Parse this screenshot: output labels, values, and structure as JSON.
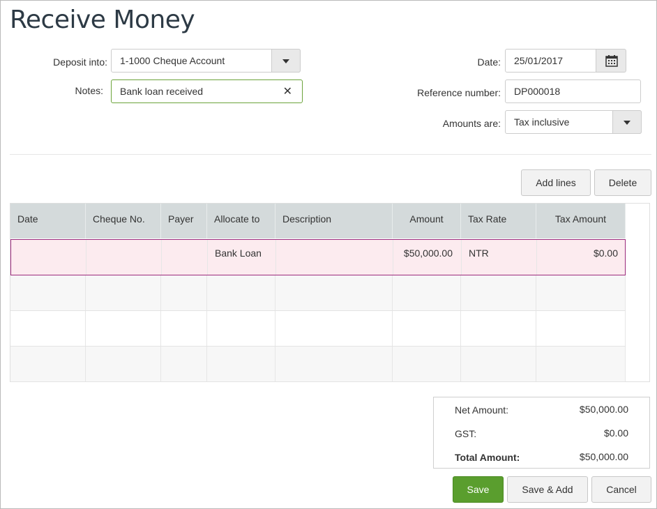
{
  "page": {
    "title": "Receive Money"
  },
  "form": {
    "deposit_label": "Deposit into:",
    "deposit_value": "1-1000 Cheque Account",
    "notes_label": "Notes:",
    "notes_value": "Bank loan received",
    "date_label": "Date:",
    "date_value": "25/01/2017",
    "reference_label": "Reference number:",
    "reference_value": "DP000018",
    "amounts_label": "Amounts are:",
    "amounts_value": "Tax inclusive"
  },
  "toolbar": {
    "add_lines": "Add lines",
    "delete": "Delete"
  },
  "grid": {
    "columns": [
      "Date",
      "Cheque No.",
      "Payer",
      "Allocate to",
      "Description",
      "Amount",
      "Tax Rate",
      "Tax Amount"
    ],
    "rows": [
      {
        "date": "",
        "cheque": "",
        "payer": "",
        "allocate": "Bank Loan",
        "description": "",
        "amount": "$50,000.00",
        "tax_rate": "NTR",
        "tax_amount": "$0.00"
      }
    ]
  },
  "totals": {
    "net_label": "Net Amount:",
    "net_value": "$50,000.00",
    "gst_label": "GST:",
    "gst_value": "$0.00",
    "total_label": "Total Amount:",
    "total_value": "$50,000.00"
  },
  "actions": {
    "save": "Save",
    "save_add": "Save & Add",
    "cancel": "Cancel"
  },
  "colors": {
    "primary": "#5a9e2e",
    "selected_row": "#fcebef",
    "selected_border": "#9b2a7c",
    "header_bg": "#d4dadb"
  }
}
